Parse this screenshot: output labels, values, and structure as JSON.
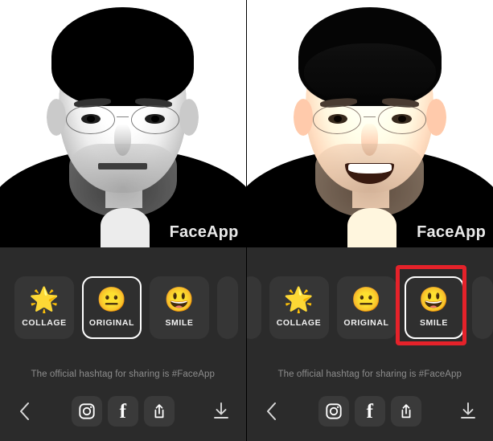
{
  "app": {
    "name": "FaceApp",
    "watermark": "FaceApp",
    "panel_count": 2
  },
  "colors": {
    "panel_bg": "#2b2b2b",
    "tile_bg": "#363636",
    "selection_border": "#ffffff",
    "highlight_box": "#e5222a",
    "caption_text": "#f2f2f2",
    "hashtag_text": "#8d8d8d",
    "photo_bg": "#fdfdfd"
  },
  "panels": [
    {
      "id": "before",
      "photo": {
        "watermark": "FaceApp",
        "style": "black-and-white",
        "expression": "neutral",
        "subject": "man with round glasses in black turtleneck"
      },
      "filters": [
        {
          "label": "COLLAGE",
          "icon": "star-emoji",
          "glyph": "🌟",
          "selected": false,
          "partial": false
        },
        {
          "label": "ORIGINAL",
          "icon": "neutral-face-emoji",
          "glyph": "😐",
          "selected": true,
          "partial": false
        },
        {
          "label": "SMILE",
          "icon": "grinning-face-emoji",
          "glyph": "😃",
          "selected": false,
          "partial": false
        },
        {
          "label": "",
          "icon": "cut-off-tile",
          "glyph": "",
          "selected": false,
          "partial": true
        }
      ],
      "hashtag": "The official hashtag for sharing is #FaceApp",
      "bottom_bar": {
        "back": "chevron-left-icon",
        "share": [
          {
            "name": "instagram-icon",
            "label": "Instagram"
          },
          {
            "name": "facebook-icon",
            "label": "f"
          },
          {
            "name": "share-icon",
            "label": "Share"
          }
        ],
        "download": "download-icon"
      },
      "highlight": false
    },
    {
      "id": "after",
      "photo": {
        "watermark": "FaceApp",
        "style": "colorized",
        "expression": "smiling",
        "subject": "same man smiling with teeth visible"
      },
      "filters": [
        {
          "label": "",
          "icon": "cut-off-tile",
          "glyph": "",
          "selected": false,
          "partial": true
        },
        {
          "label": "COLLAGE",
          "icon": "star-emoji",
          "glyph": "🌟",
          "selected": false,
          "partial": false
        },
        {
          "label": "ORIGINAL",
          "icon": "neutral-face-emoji",
          "glyph": "😐",
          "selected": false,
          "partial": false
        },
        {
          "label": "SMILE",
          "icon": "grinning-face-emoji",
          "glyph": "😃",
          "selected": true,
          "partial": false
        },
        {
          "label": "",
          "icon": "cut-off-tile",
          "glyph": "",
          "selected": false,
          "partial": true
        }
      ],
      "hashtag": "The official hashtag for sharing is #FaceApp",
      "bottom_bar": {
        "back": "chevron-left-icon",
        "share": [
          {
            "name": "instagram-icon",
            "label": "Instagram"
          },
          {
            "name": "facebook-icon",
            "label": "f"
          },
          {
            "name": "share-icon",
            "label": "Share"
          }
        ],
        "download": "download-icon"
      },
      "highlight": true,
      "highlight_target": "SMILE"
    }
  ]
}
